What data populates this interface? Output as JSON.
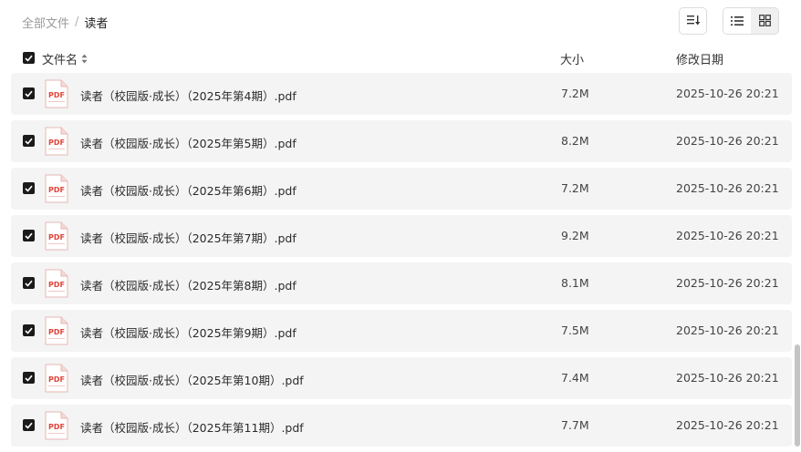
{
  "breadcrumb": {
    "root": "全部文件",
    "separator": "/",
    "current": "读者"
  },
  "table": {
    "header": {
      "name": "文件名",
      "size": "大小",
      "modified": "修改日期"
    },
    "rows": [
      {
        "name": "读者（校园版·成长）（2025年第4期）.pdf",
        "size": "7.2M",
        "modified": "2025-10-26 20:21"
      },
      {
        "name": "读者（校园版·成长）（2025年第5期）.pdf",
        "size": "8.2M",
        "modified": "2025-10-26 20:21"
      },
      {
        "name": "读者（校园版·成长）（2025年第6期）.pdf",
        "size": "7.2M",
        "modified": "2025-10-26 20:21"
      },
      {
        "name": "读者（校园版·成长）（2025年第7期）.pdf",
        "size": "9.2M",
        "modified": "2025-10-26 20:21"
      },
      {
        "name": "读者（校园版·成长）（2025年第8期）.pdf",
        "size": "8.1M",
        "modified": "2025-10-26 20:21"
      },
      {
        "name": "读者（校园版·成长）（2025年第9期）.pdf",
        "size": "7.5M",
        "modified": "2025-10-26 20:21"
      },
      {
        "name": "读者（校园版·成长）（2025年第10期）.pdf",
        "size": "7.4M",
        "modified": "2025-10-26 20:21"
      },
      {
        "name": "读者（校园版·成长）（2025年第11期）.pdf",
        "size": "7.7M",
        "modified": "2025-10-26 20:21"
      }
    ]
  },
  "icons": {
    "file": "pdf-file-icon",
    "sort": "sort-icon",
    "list": "list-view-icon",
    "grid": "grid-view-icon",
    "check": "check-icon"
  },
  "colors": {
    "pdf_red": "#e0443a",
    "row_bg": "#f4f4f4",
    "checkbox": "#1a1a1a"
  }
}
